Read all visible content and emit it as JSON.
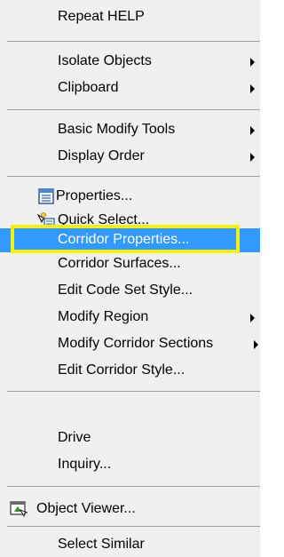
{
  "menu": {
    "items": [
      {
        "key": "repeat_help",
        "label": "Repeat HELP",
        "submenu": false
      },
      {
        "key": "isolate_objects",
        "label": "Isolate Objects",
        "submenu": true
      },
      {
        "key": "clipboard",
        "label": "Clipboard",
        "submenu": true
      },
      {
        "key": "basic_modify_tools",
        "label": "Basic Modify Tools",
        "submenu": true
      },
      {
        "key": "display_order",
        "label": "Display Order",
        "submenu": true
      },
      {
        "key": "properties",
        "label": "Properties...",
        "icon": "properties-icon"
      },
      {
        "key": "quick_select",
        "label": "Quick Select...",
        "icon": "quick-select-icon"
      },
      {
        "key": "corridor_properties",
        "label": "Corridor Properties...",
        "highlighted": true
      },
      {
        "key": "corridor_surfaces",
        "label": "Corridor Surfaces..."
      },
      {
        "key": "edit_code_set_style",
        "label": "Edit Code Set Style..."
      },
      {
        "key": "modify_region",
        "label": "Modify Region",
        "submenu": true
      },
      {
        "key": "modify_corridor_sections",
        "label": "Modify Corridor Sections",
        "submenu": true
      },
      {
        "key": "edit_corridor_style",
        "label": "Edit Corridor Style..."
      },
      {
        "key": "drive",
        "label": "Drive"
      },
      {
        "key": "inquiry",
        "label": "Inquiry..."
      },
      {
        "key": "object_viewer",
        "label": "Object Viewer...",
        "icon": "object-viewer-icon"
      },
      {
        "key": "select_similar",
        "label": "Select Similar"
      }
    ]
  },
  "colors": {
    "menu_background": "#f0f0f0",
    "highlight": "#3399ff",
    "callout_border": "#f4f112"
  }
}
